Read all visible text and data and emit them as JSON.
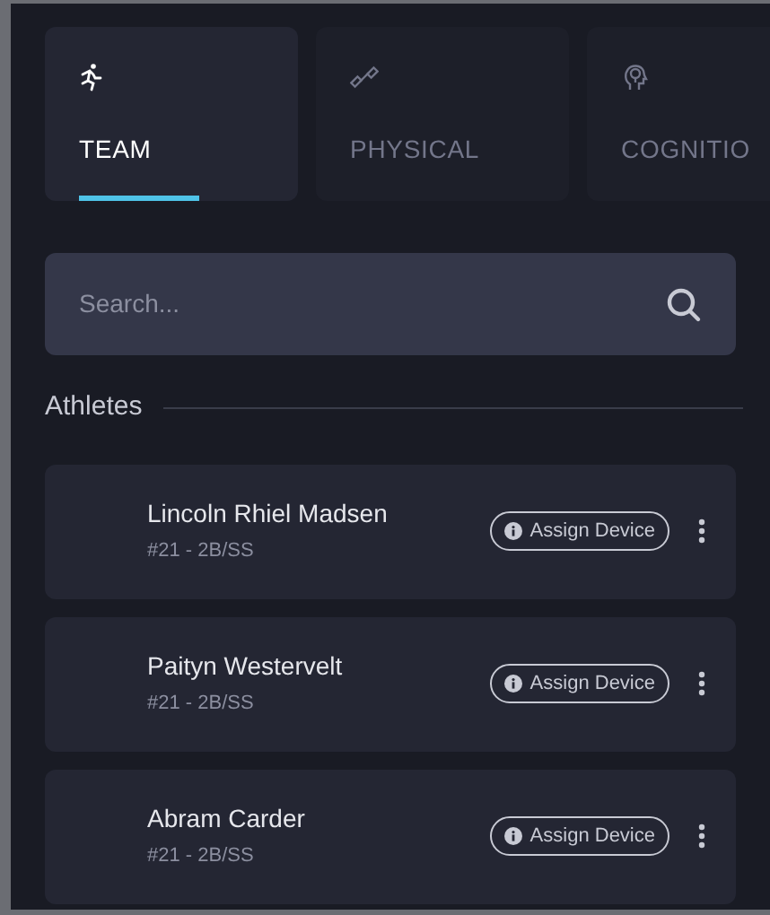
{
  "tabs": [
    {
      "label": "TEAM",
      "kind": "team",
      "selected": true
    },
    {
      "label": "PHYSICAL",
      "kind": "physical",
      "selected": false
    },
    {
      "label": "COGNITIO",
      "kind": "cognition",
      "selected": false
    }
  ],
  "search": {
    "placeholder": "Search..."
  },
  "section": {
    "title": "Athletes"
  },
  "athletes": [
    {
      "name": "Lincoln Rhiel Madsen",
      "detail": "#21 - 2B/SS",
      "action": "Assign Device"
    },
    {
      "name": "Paityn Westervelt",
      "detail": "#21 - 2B/SS",
      "action": "Assign Device"
    },
    {
      "name": "Abram Carder",
      "detail": "#21 - 2B/SS",
      "action": "Assign Device"
    }
  ]
}
